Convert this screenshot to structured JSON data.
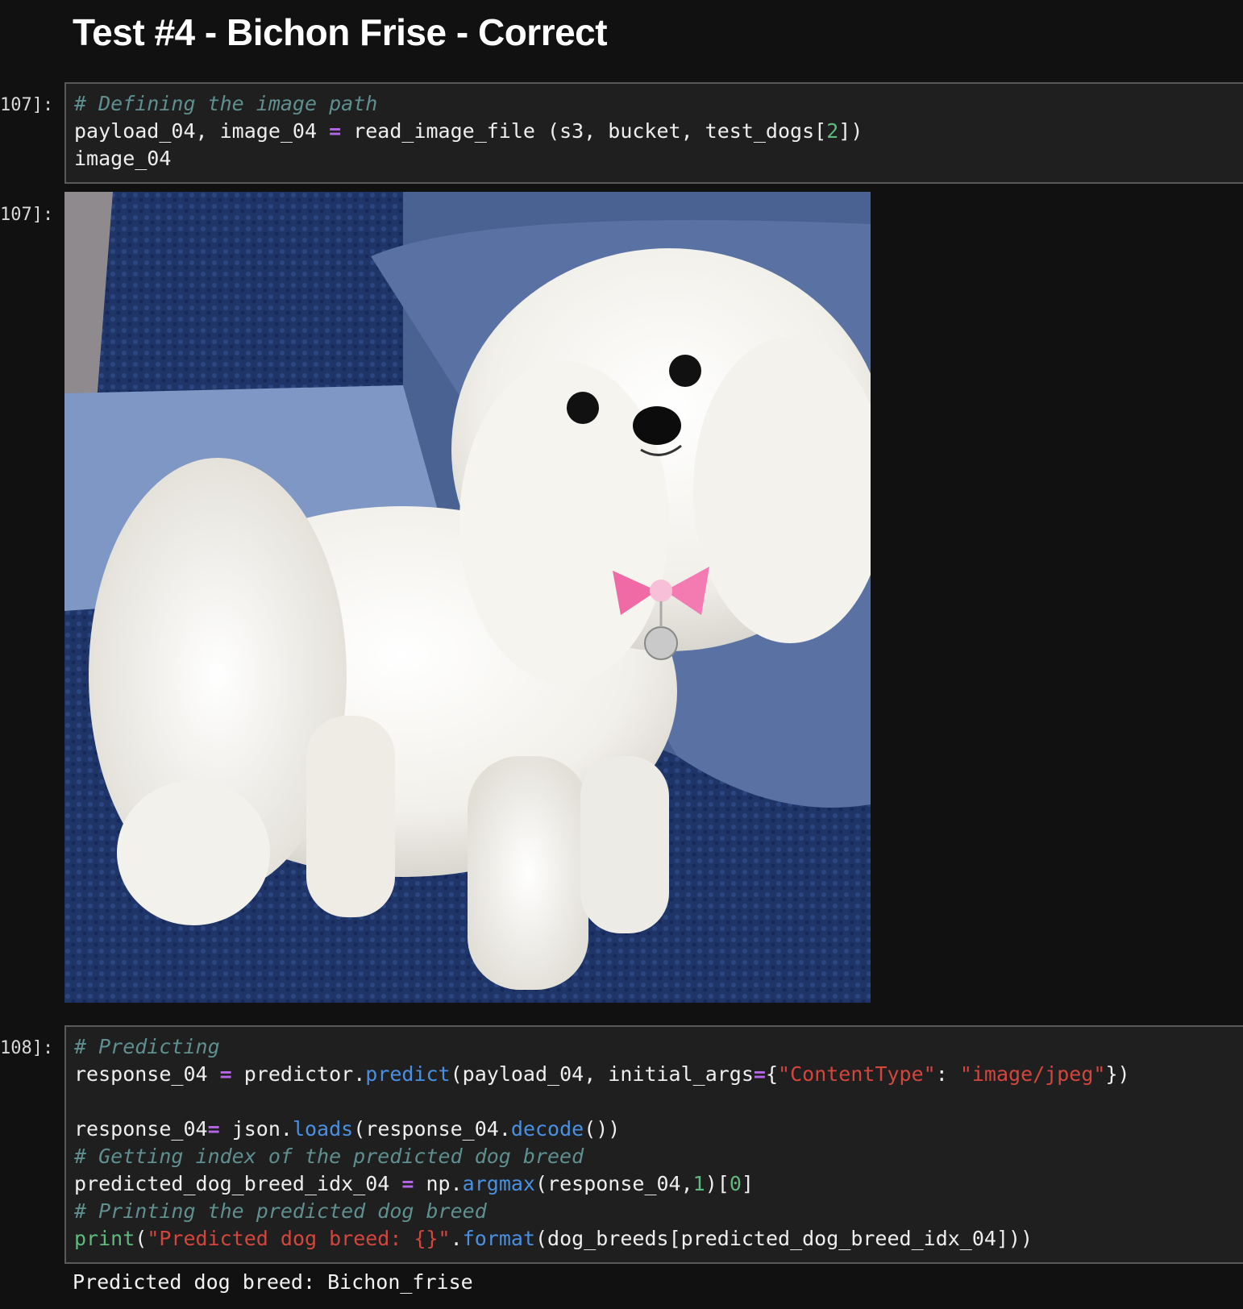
{
  "heading": "Test #4 - Bichon Frise - Correct",
  "cells": [
    {
      "prompt": "107]:",
      "lines": [
        [
          {
            "t": "# Defining the image path",
            "k": "c"
          }
        ],
        [
          {
            "t": "payload_04, image_04 ",
            "k": ""
          },
          {
            "t": "=",
            "k": "op"
          },
          {
            "t": " read_image_file (s3, bucket, test_dogs[",
            "k": ""
          },
          {
            "t": "2",
            "k": "n"
          },
          {
            "t": "])",
            "k": ""
          }
        ],
        [
          {
            "t": "image_04",
            "k": ""
          }
        ]
      ]
    },
    {
      "prompt": "108]:",
      "lines": [
        [
          {
            "t": "# Predicting",
            "k": "c"
          }
        ],
        [
          {
            "t": "response_04 ",
            "k": ""
          },
          {
            "t": "=",
            "k": "op"
          },
          {
            "t": " predictor.",
            "k": ""
          },
          {
            "t": "predict",
            "k": "fn"
          },
          {
            "t": "(payload_04, initial_args",
            "k": ""
          },
          {
            "t": "=",
            "k": "op"
          },
          {
            "t": "{",
            "k": ""
          },
          {
            "t": "\"ContentType\"",
            "k": "s"
          },
          {
            "t": ": ",
            "k": ""
          },
          {
            "t": "\"image/jpeg\"",
            "k": "s"
          },
          {
            "t": "})",
            "k": ""
          }
        ],
        [],
        [
          {
            "t": "response_04",
            "k": ""
          },
          {
            "t": "=",
            "k": "op"
          },
          {
            "t": " json.",
            "k": ""
          },
          {
            "t": "loads",
            "k": "fn"
          },
          {
            "t": "(response_04.",
            "k": ""
          },
          {
            "t": "decode",
            "k": "fn"
          },
          {
            "t": "())",
            "k": ""
          }
        ],
        [
          {
            "t": "# Getting index of the predicted dog breed",
            "k": "c"
          }
        ],
        [
          {
            "t": "predicted_dog_breed_idx_04 ",
            "k": ""
          },
          {
            "t": "=",
            "k": "op"
          },
          {
            "t": " np.",
            "k": ""
          },
          {
            "t": "argmax",
            "k": "fn"
          },
          {
            "t": "(response_04,",
            "k": ""
          },
          {
            "t": "1",
            "k": "n"
          },
          {
            "t": ")[",
            "k": ""
          },
          {
            "t": "0",
            "k": "n"
          },
          {
            "t": "]",
            "k": ""
          }
        ],
        [
          {
            "t": "# Printing the predicted dog breed",
            "k": "c"
          }
        ],
        [
          {
            "t": "print",
            "k": "bi"
          },
          {
            "t": "(",
            "k": ""
          },
          {
            "t": "\"Predicted dog breed: {}\"",
            "k": "s"
          },
          {
            "t": ".",
            "k": ""
          },
          {
            "t": "format",
            "k": "fn"
          },
          {
            "t": "(dog_breeds[predicted_dog_breed_idx_04]))",
            "k": ""
          }
        ]
      ]
    }
  ],
  "output_prompt": "107]:",
  "output_text": "Predicted dog breed: Bichon_frise",
  "colors": {
    "background": "#111111",
    "cell_background": "#1f1f1f",
    "comment": "#5f8f8f",
    "operator": "#b565e8",
    "number": "#5fba7d",
    "string": "#d4463d",
    "function": "#4a90e2"
  }
}
